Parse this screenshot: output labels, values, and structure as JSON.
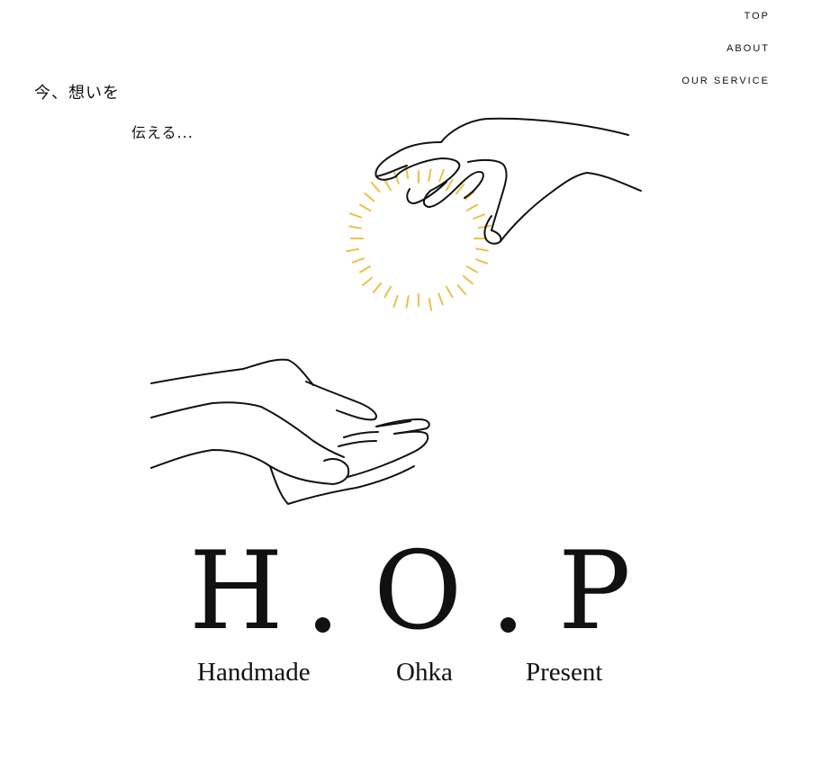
{
  "nav": {
    "items": [
      "TOP",
      "ABOUT",
      "OUR SERVICE"
    ]
  },
  "tagline": {
    "line1": "今、想いを",
    "line2": "伝える..."
  },
  "brand": {
    "letters": [
      "H",
      "O",
      "P"
    ],
    "words": [
      "Handmade",
      "Ohka",
      "Present"
    ]
  },
  "colors": {
    "text": "#111111",
    "accent_glow": "#e8c24a",
    "background": "#ffffff"
  },
  "illustration": {
    "icon": "giving-hands-illustration"
  }
}
